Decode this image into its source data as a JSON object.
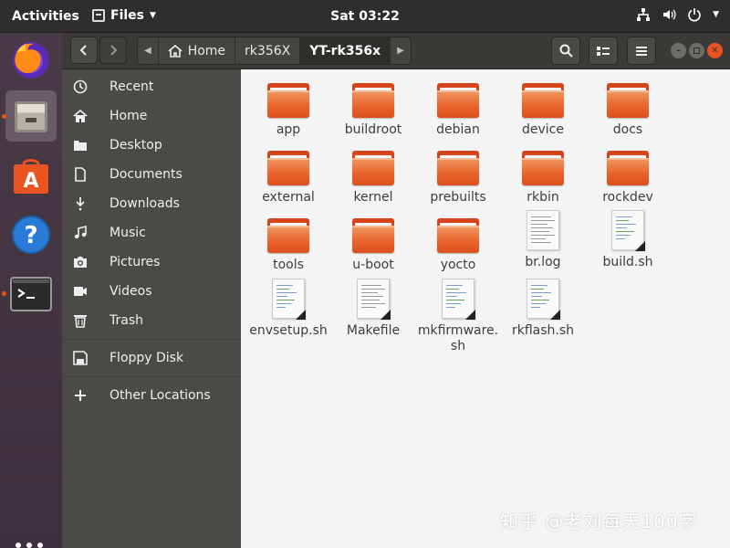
{
  "topbar": {
    "activities": "Activities",
    "app_name": "Files",
    "clock": "Sat 03:22"
  },
  "dock": {
    "apps": [
      "firefox-icon",
      "files-icon",
      "software-center-icon",
      "help-icon",
      "terminal-icon"
    ]
  },
  "header": {
    "breadcrumbs": [
      "Home",
      "rk356X",
      "YT-rk356x"
    ]
  },
  "sidebar": {
    "items": [
      {
        "label": "Recent",
        "icon": "clock-icon"
      },
      {
        "label": "Home",
        "icon": "home-icon"
      },
      {
        "label": "Desktop",
        "icon": "desktop-folder-icon"
      },
      {
        "label": "Documents",
        "icon": "document-icon"
      },
      {
        "label": "Downloads",
        "icon": "download-icon"
      },
      {
        "label": "Music",
        "icon": "music-icon"
      },
      {
        "label": "Pictures",
        "icon": "camera-icon"
      },
      {
        "label": "Videos",
        "icon": "video-icon"
      },
      {
        "label": "Trash",
        "icon": "trash-icon"
      },
      {
        "label": "Floppy Disk",
        "icon": "floppy-icon"
      },
      {
        "label": "Other Locations",
        "icon": "plus-icon"
      }
    ]
  },
  "files": [
    {
      "name": "app",
      "type": "folder"
    },
    {
      "name": "buildroot",
      "type": "folder"
    },
    {
      "name": "debian",
      "type": "folder"
    },
    {
      "name": "device",
      "type": "folder"
    },
    {
      "name": "docs",
      "type": "folder"
    },
    {
      "name": "external",
      "type": "folder"
    },
    {
      "name": "kernel",
      "type": "folder"
    },
    {
      "name": "prebuilts",
      "type": "folder"
    },
    {
      "name": "rkbin",
      "type": "folder"
    },
    {
      "name": "rockdev",
      "type": "folder"
    },
    {
      "name": "tools",
      "type": "folder"
    },
    {
      "name": "u-boot",
      "type": "folder"
    },
    {
      "name": "yocto",
      "type": "folder"
    },
    {
      "name": "br.log",
      "type": "text"
    },
    {
      "name": "build.sh",
      "type": "script"
    },
    {
      "name": "envsetup.sh",
      "type": "script"
    },
    {
      "name": "Makefile",
      "type": "text"
    },
    {
      "name": "mkfirmware.sh",
      "type": "script"
    },
    {
      "name": "rkflash.sh",
      "type": "script"
    }
  ],
  "watermark": "知乎 @老刘每天100字"
}
